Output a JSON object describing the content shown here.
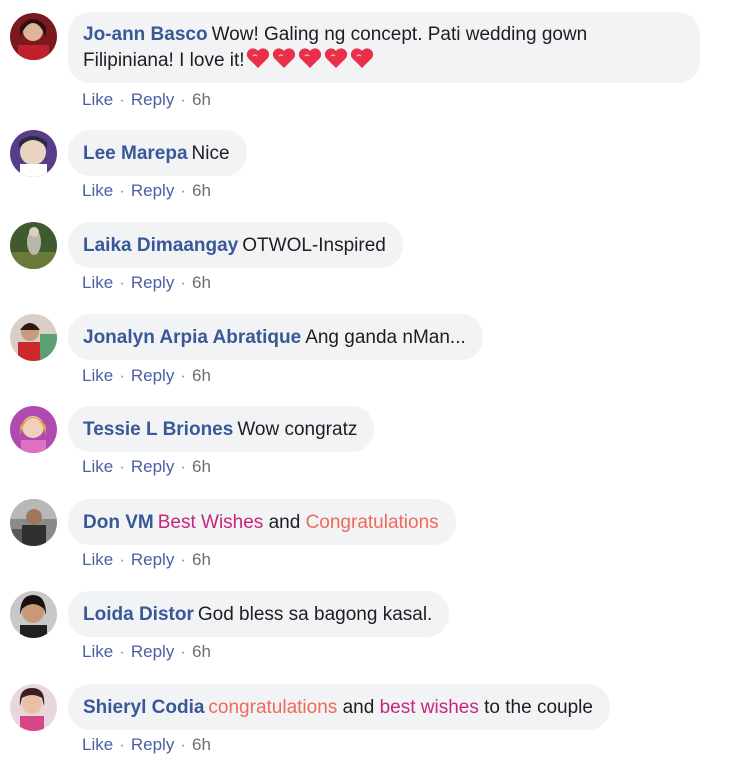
{
  "comments": [
    {
      "author": "Jo-ann Basco",
      "segments": [
        {
          "text": "Wow! Galing ng concept. Pati wedding gown Filipiniana! I love it!",
          "style": "normal"
        }
      ],
      "emoji": [
        "heart-icon",
        "heart-icon",
        "heart-icon",
        "heart-icon",
        "heart-icon"
      ],
      "like_label": "Like",
      "reply_label": "Reply",
      "time": "6h"
    },
    {
      "author": "Lee Marepa",
      "segments": [
        {
          "text": "Nice",
          "style": "normal"
        }
      ],
      "like_label": "Like",
      "reply_label": "Reply",
      "time": "6h"
    },
    {
      "author": "Laika Dimaangay",
      "segments": [
        {
          "text": "OTWOL-Inspired",
          "style": "normal"
        }
      ],
      "like_label": "Like",
      "reply_label": "Reply",
      "time": "6h"
    },
    {
      "author": "Jonalyn Arpia Abratique",
      "segments": [
        {
          "text": "Ang ganda nMan...",
          "style": "normal"
        }
      ],
      "like_label": "Like",
      "reply_label": "Reply",
      "time": "6h"
    },
    {
      "author": "Tessie L Briones",
      "segments": [
        {
          "text": "Wow congratz",
          "style": "normal"
        }
      ],
      "like_label": "Like",
      "reply_label": "Reply",
      "time": "6h"
    },
    {
      "author": "Don VM",
      "segments": [
        {
          "text": "Best Wishes",
          "style": "pink"
        },
        {
          "text": " and ",
          "style": "normal"
        },
        {
          "text": "Congratulations",
          "style": "orange"
        }
      ],
      "like_label": "Like",
      "reply_label": "Reply",
      "time": "6h"
    },
    {
      "author": "Loida Distor",
      "segments": [
        {
          "text": "God bless sa bagong kasal.",
          "style": "normal"
        }
      ],
      "like_label": "Like",
      "reply_label": "Reply",
      "time": "6h"
    },
    {
      "author": "Shieryl Codia",
      "segments": [
        {
          "text": "congratulations",
          "style": "orange"
        },
        {
          "text": " and ",
          "style": "normal"
        },
        {
          "text": "best wishes",
          "style": "pink"
        },
        {
          "text": " to the couple",
          "style": "normal"
        }
      ],
      "like_label": "Like",
      "reply_label": "Reply",
      "time": "6h"
    }
  ],
  "separator": "·",
  "colors": {
    "author": "#385898",
    "bubble_bg": "#f2f3f5",
    "highlight_pink": "#c4287c",
    "highlight_orange": "#f0695a"
  }
}
